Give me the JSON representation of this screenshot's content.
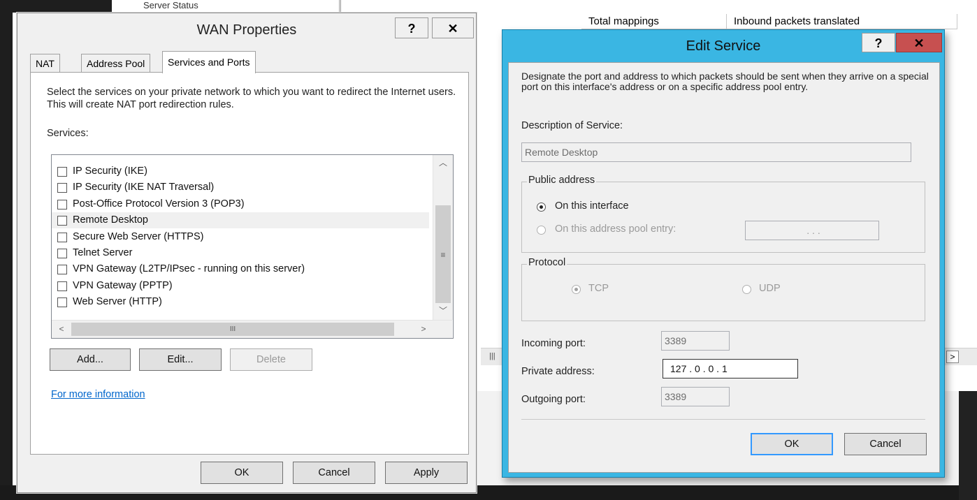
{
  "background": {
    "tree_item": "Server Status",
    "columns": [
      "Total mappings",
      "Inbound packets translated"
    ]
  },
  "wan_dialog": {
    "title": "WAN Properties",
    "help_button": "?",
    "close_button": "✕",
    "tabs": [
      "NAT",
      "Address Pool",
      "Services and Ports"
    ],
    "active_tab": "Services and Ports",
    "description": "Select the services on your private network to which you want to redirect the Internet users. This will create NAT port redirection rules.",
    "services_label": "Services:",
    "services": [
      {
        "label": "IP Security (IKE)",
        "checked": false
      },
      {
        "label": "IP Security (IKE NAT Traversal)",
        "checked": false
      },
      {
        "label": "Post-Office Protocol Version 3 (POP3)",
        "checked": false
      },
      {
        "label": "Remote Desktop",
        "checked": false,
        "selected": true
      },
      {
        "label": "Secure Web Server (HTTPS)",
        "checked": false
      },
      {
        "label": "Telnet Server",
        "checked": false
      },
      {
        "label": "VPN Gateway (L2TP/IPsec - running on this server)",
        "checked": false
      },
      {
        "label": "VPN Gateway (PPTP)",
        "checked": false
      },
      {
        "label": "Web Server (HTTP)",
        "checked": false
      }
    ],
    "add_button": "Add...",
    "edit_button": "Edit...",
    "delete_button": "Delete",
    "more_info_link": "For more information",
    "ok_button": "OK",
    "cancel_button": "Cancel",
    "apply_button": "Apply"
  },
  "edit_dialog": {
    "title": "Edit Service",
    "help_button": "?",
    "close_button": "✕",
    "description": "Designate the port and address to which packets should be sent when they arrive on a special port on this interface's address or on a specific address pool entry.",
    "description_label": "Description of Service:",
    "description_value": "Remote Desktop",
    "public_address_label": "Public address",
    "on_interface_label": "On this interface",
    "on_pool_label": "On this address pool entry:",
    "pool_ip_value": ".     .     .",
    "protocol_label": "Protocol",
    "tcp_label": "TCP",
    "udp_label": "UDP",
    "incoming_port_label": "Incoming port:",
    "incoming_port_value": "3389",
    "private_address_label": "Private address:",
    "private_address_value": "127 .  0  .  0  .  1",
    "outgoing_port_label": "Outgoing port:",
    "outgoing_port_value": "3389",
    "ok_button": "OK",
    "cancel_button": "Cancel"
  }
}
